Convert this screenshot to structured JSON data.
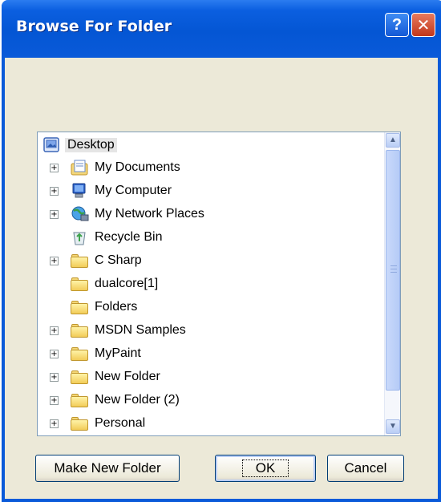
{
  "window": {
    "title": "Browse For Folder",
    "help_glyph": "?",
    "close_glyph": "✕"
  },
  "tree": {
    "root": {
      "label": "Desktop",
      "icon": "desktop-icon"
    },
    "items": [
      {
        "label": "My Documents",
        "icon": "my-documents-icon",
        "expandable": true
      },
      {
        "label": "My Computer",
        "icon": "my-computer-icon",
        "expandable": true
      },
      {
        "label": "My Network Places",
        "icon": "network-places-icon",
        "expandable": true
      },
      {
        "label": "Recycle Bin",
        "icon": "recycle-bin-icon",
        "expandable": false
      },
      {
        "label": "C Sharp",
        "icon": "folder-icon",
        "expandable": true
      },
      {
        "label": "dualcore[1]",
        "icon": "folder-icon",
        "expandable": false
      },
      {
        "label": "Folders",
        "icon": "folder-icon",
        "expandable": false
      },
      {
        "label": "MSDN Samples",
        "icon": "folder-icon",
        "expandable": true
      },
      {
        "label": "MyPaint",
        "icon": "folder-icon",
        "expandable": true
      },
      {
        "label": "New Folder",
        "icon": "folder-icon",
        "expandable": true
      },
      {
        "label": "New Folder (2)",
        "icon": "folder-icon",
        "expandable": true
      },
      {
        "label": "Personal",
        "icon": "folder-icon",
        "expandable": true
      }
    ],
    "expander_glyph": "+"
  },
  "buttons": {
    "make_new_folder": "Make New Folder",
    "ok": "OK",
    "cancel": "Cancel"
  },
  "colors": {
    "titlebar": "#0a5ad9",
    "dialog_bg": "#ece9d8",
    "selection_bg": "#e5e5e5"
  }
}
